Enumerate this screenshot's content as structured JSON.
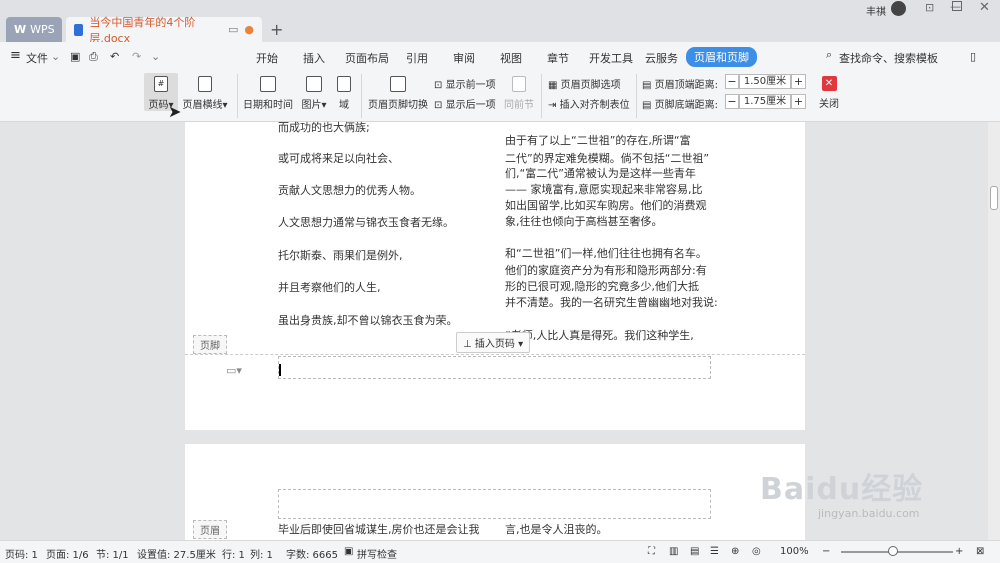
{
  "titlebar": {
    "wps_tab": "WPS",
    "doc_tab": "当今中国青年的4个阶层.docx",
    "user_name": "丰祺"
  },
  "menubar": {
    "file": "文件",
    "items": [
      "开始",
      "插入",
      "页面布局",
      "引用",
      "审阅",
      "视图",
      "章节",
      "开发工具",
      "云服务",
      "页眉和页脚"
    ],
    "search": "查找命令、搜索模板"
  },
  "ribbon": {
    "page_number": "页码",
    "header_line": "页眉横线",
    "date_time": "日期和时间",
    "picture": "图片",
    "field": "域",
    "hf_switch": "页眉页脚切换",
    "show_prev": "显示前一项",
    "show_next": "显示后一项",
    "same_as_prev": "同前节",
    "hf_options": "页眉页脚选项",
    "insert_align_tab": "插入对齐制表位",
    "header_top_label": "页眉顶端距离:",
    "header_top_value": "1.50厘米",
    "footer_bottom_label": "页脚底端距离:",
    "footer_bottom_value": "1.75厘米",
    "close": "关闭"
  },
  "doc": {
    "left_col": [
      "而成功的也大俩族;",
      "或可成将来足以向社会、",
      "贡献人文思想力的优秀人物。",
      "人文思想力通常与锦衣玉食者无缘。",
      "托尔斯泰、雨果们是例外,",
      "并且考察他们的人生,",
      "虽出身贵族,却不曾以锦衣玉食为荣。"
    ],
    "right_col": [
      "由于有了以上“二世祖”的存在,所谓“富",
      "二代”的界定难免模糊。倘不包括“二世祖”",
      "们,“富二代”通常被认为是这样一些青年",
      "—— 家境富有,意愿实现起来非常容易,比",
      "如出国留学,比如买车购房。他们的消费观",
      "象,往往也倾向于高档甚至奢侈。",
      "和“二世祖”们一样,他们往往也拥有名车。",
      "他们的家庭资产分为有形和隐形两部分:有",
      "形的已很可观,隐形的究竟多少,他们大抵",
      "并不清楚。我的一名研究生曾幽幽地对我说:",
      "“老师,人比人真是得死。我们这种学生,"
    ],
    "footer_label": "页脚",
    "insert_page_number": "插入页码",
    "header_label": "页眉",
    "page2_left": "毕业后即使回省城谋生,房价也还是会让我",
    "page2_right": "言,也是令人沮丧的。"
  },
  "status": {
    "page_no": "页码: 1",
    "pages": "页面: 1/6",
    "section": "节: 1/1",
    "setting": "设置值: 27.5厘米",
    "row": "行: 1",
    "col": "列: 1",
    "word_count": "字数: 6665",
    "spell": "拼写检查",
    "zoom": "100%"
  },
  "watermark": {
    "text": "Baidu经验",
    "url": "jingyan.baidu.com"
  }
}
